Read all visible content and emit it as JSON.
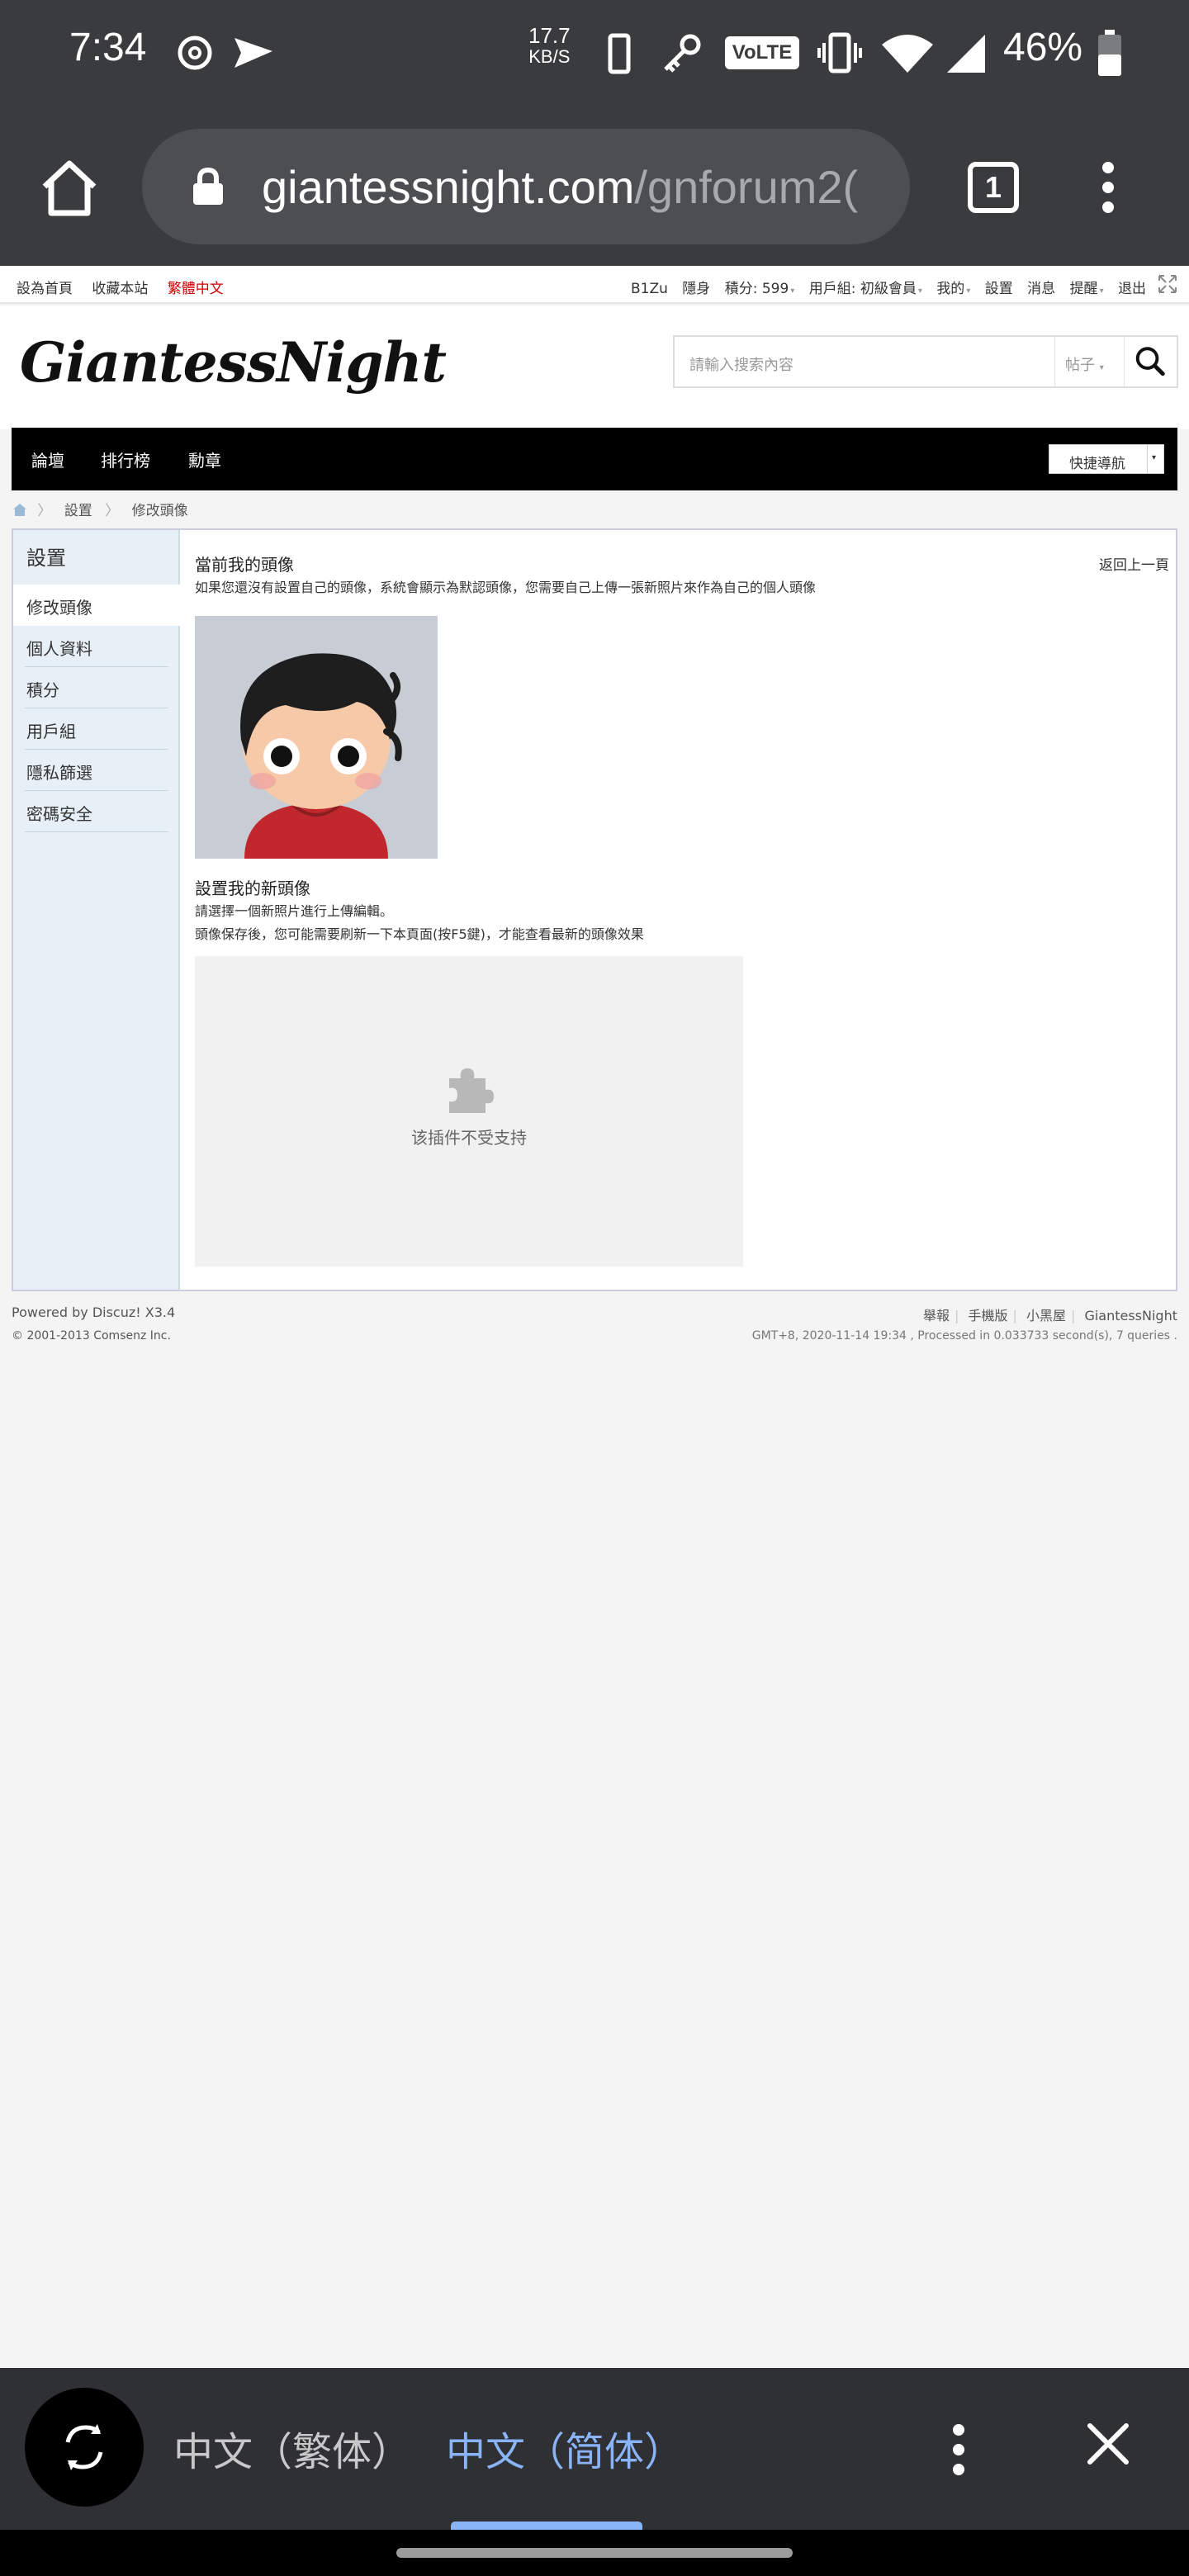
{
  "status_bar": {
    "time": "7:34",
    "speed_value": "17.7",
    "speed_unit": "KB/S",
    "volte": "VoLTE",
    "battery": "46%"
  },
  "browser": {
    "url_main": "giantessnight.com",
    "url_rest": "/gnforum2(",
    "tab_count": "1"
  },
  "site": {
    "topbar_left": [
      "設為首頁",
      "收藏本站",
      "繁體中文"
    ],
    "topbar_right": [
      "B1Zu",
      "隱身",
      "積分: 599",
      "用戶組: 初級會員",
      "我的",
      "設置",
      "消息",
      "提醒",
      "退出"
    ],
    "logo": "GiantessNight",
    "search_placeholder": "請輸入搜索內容",
    "search_type": "帖子",
    "nav": [
      "論壇",
      "排行榜",
      "勳章"
    ],
    "quicknav": "快捷導航",
    "breadcrumb": [
      "設置",
      "修改頭像"
    ]
  },
  "sidebar": {
    "title": "設置",
    "items": [
      "修改頭像",
      "個人資料",
      "積分",
      "用戶組",
      "隱私篩選",
      "密碼安全"
    ]
  },
  "main": {
    "current_title": "當前我的頭像",
    "back": "返回上一頁",
    "current_desc": "如果您還沒有設置自己的頭像，系統會顯示為默認頭像，您需要自己上傳一張新照片來作為自己的個人頭像",
    "new_title": "設置我的新頭像",
    "new_desc1": "請選擇一個新照片進行上傳編輯。",
    "new_desc2": "頭像保存後，您可能需要刷新一下本頁面(按F5鍵)，才能查看最新的頭像效果",
    "plugin_msg": "该插件不受支持"
  },
  "footer": {
    "powered": "Powered by Discuz! X3.4",
    "copyright": "© 2001-2013 Comsenz Inc.",
    "links": [
      "舉報",
      "手機版",
      "小黑屋",
      "GiantessNight"
    ],
    "processed": "GMT+8, 2020-11-14 19:34 , Processed in 0.033733 second(s), 7 queries ."
  },
  "translate_bar": {
    "lang1": "中文（繁体）",
    "lang2": "中文（简体）"
  }
}
